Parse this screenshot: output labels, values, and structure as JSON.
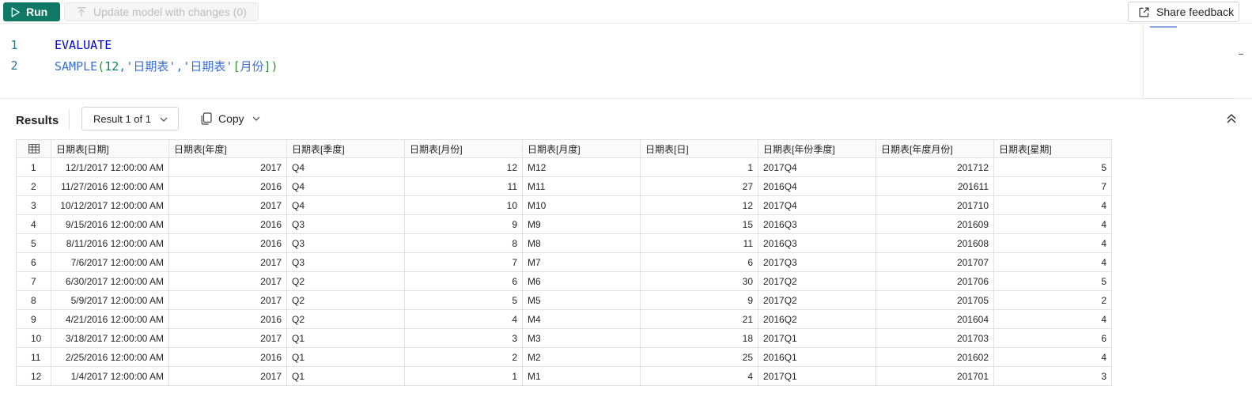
{
  "toolbar": {
    "run_label": "Run",
    "update_label": "Update model with changes (0)",
    "feedback_label": "Share feedback"
  },
  "editor": {
    "lines": [
      {
        "number": "1",
        "text": "EVALUATE"
      },
      {
        "number": "2",
        "text": "SAMPLE(12,'日期表','日期表'[月份])"
      }
    ],
    "tokens": {
      "line1_kw": "EVALUATE",
      "line2_fn": "SAMPLE",
      "line2_open": "(",
      "line2_num": "12",
      "line2_comma1": ",",
      "line2_str1": "'日期表'",
      "line2_comma2": ",",
      "line2_str2": "'日期表'",
      "line2_bopen": "[",
      "line2_col": "月份",
      "line2_bclose": "]",
      "line2_close": ")"
    }
  },
  "results": {
    "title": "Results",
    "selector_value": "Result 1 of 1",
    "copy_label": "Copy"
  },
  "table": {
    "columns": [
      "日期表[日期]",
      "日期表[年度]",
      "日期表[季度]",
      "日期表[月份]",
      "日期表[月度]",
      "日期表[日]",
      "日期表[年份季度]",
      "日期表[年度月份]",
      "日期表[星期]"
    ],
    "rows": [
      [
        "1",
        "12/1/2017 12:00:00 AM",
        "2017",
        "Q4",
        "12",
        "M12",
        "1",
        "2017Q4",
        "201712",
        "5"
      ],
      [
        "2",
        "11/27/2016 12:00:00 AM",
        "2016",
        "Q4",
        "11",
        "M11",
        "27",
        "2016Q4",
        "201611",
        "7"
      ],
      [
        "3",
        "10/12/2017 12:00:00 AM",
        "2017",
        "Q4",
        "10",
        "M10",
        "12",
        "2017Q4",
        "201710",
        "4"
      ],
      [
        "4",
        "9/15/2016 12:00:00 AM",
        "2016",
        "Q3",
        "9",
        "M9",
        "15",
        "2016Q3",
        "201609",
        "4"
      ],
      [
        "5",
        "8/11/2016 12:00:00 AM",
        "2016",
        "Q3",
        "8",
        "M8",
        "11",
        "2016Q3",
        "201608",
        "4"
      ],
      [
        "6",
        "7/6/2017 12:00:00 AM",
        "2017",
        "Q3",
        "7",
        "M7",
        "6",
        "2017Q3",
        "201707",
        "4"
      ],
      [
        "7",
        "6/30/2017 12:00:00 AM",
        "2017",
        "Q2",
        "6",
        "M6",
        "30",
        "2017Q2",
        "201706",
        "5"
      ],
      [
        "8",
        "5/9/2017 12:00:00 AM",
        "2017",
        "Q2",
        "5",
        "M5",
        "9",
        "2017Q2",
        "201705",
        "2"
      ],
      [
        "9",
        "4/21/2016 12:00:00 AM",
        "2016",
        "Q2",
        "4",
        "M4",
        "21",
        "2016Q2",
        "201604",
        "4"
      ],
      [
        "10",
        "3/18/2017 12:00:00 AM",
        "2017",
        "Q1",
        "3",
        "M3",
        "18",
        "2017Q1",
        "201703",
        "6"
      ],
      [
        "11",
        "2/25/2016 12:00:00 AM",
        "2016",
        "Q1",
        "2",
        "M2",
        "25",
        "2016Q1",
        "201602",
        "4"
      ],
      [
        "12",
        "1/4/2017 12:00:00 AM",
        "2017",
        "Q1",
        "1",
        "M1",
        "4",
        "2017Q1",
        "201701",
        "3"
      ]
    ]
  },
  "colors": {
    "run_button": "#117865",
    "keyword": "#0000cc",
    "function": "#3a6fd6",
    "number": "#098658",
    "bracket": "#319331",
    "line_number": "#237893"
  },
  "icons": {
    "run": "play-icon",
    "update": "upload-icon",
    "feedback": "external-link-icon",
    "copy": "copy-icon",
    "collapse": "chevron-double-up-icon",
    "table": "table-grid-icon"
  }
}
